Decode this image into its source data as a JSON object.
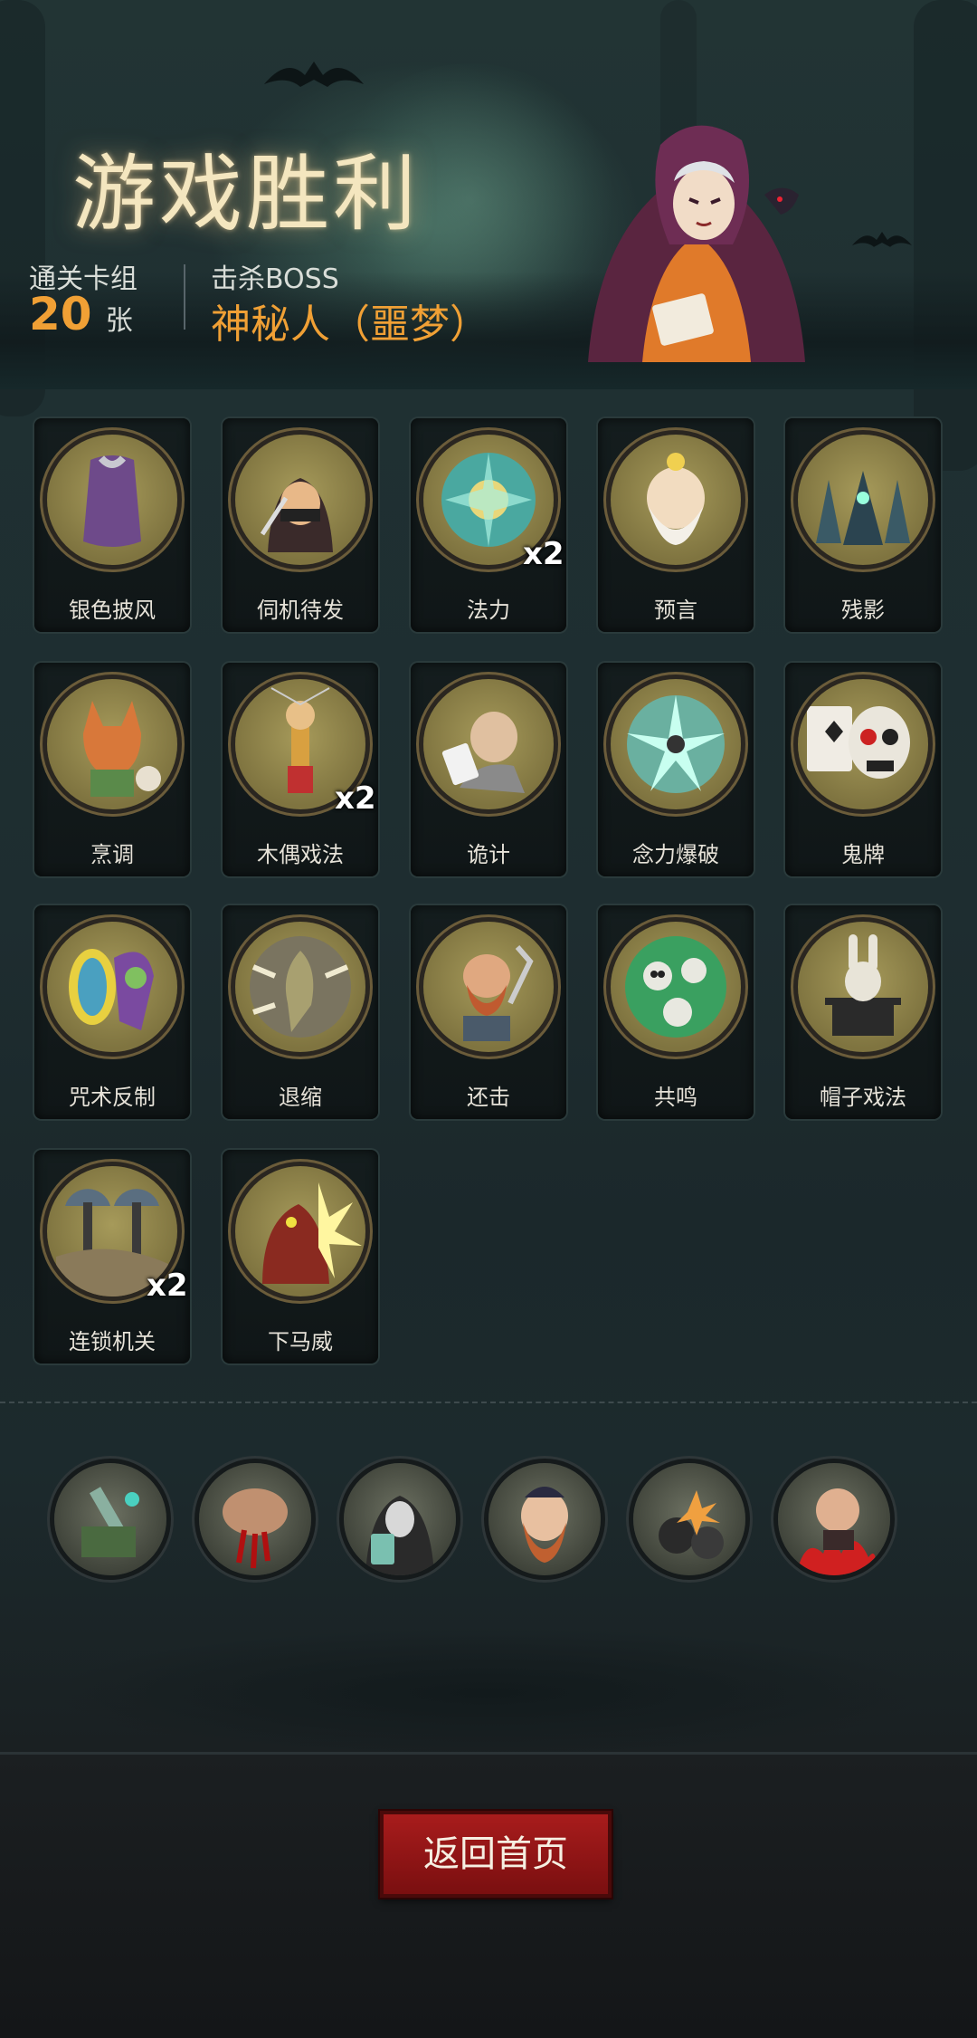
{
  "result": {
    "title": "游戏胜利",
    "deck_label": "通关卡组",
    "deck_count": "20",
    "deck_unit": "张",
    "boss_label": "击杀BOSS",
    "boss_name": "神秘人（噩梦）"
  },
  "cards": [
    {
      "name": "银色披风",
      "mult": "",
      "art": "cloak-icon"
    },
    {
      "name": "伺机待发",
      "mult": "",
      "art": "masked-thief-icon"
    },
    {
      "name": "法力",
      "mult": "x2",
      "art": "mana-burst-icon"
    },
    {
      "name": "预言",
      "mult": "",
      "art": "old-seer-icon"
    },
    {
      "name": "残影",
      "mult": "",
      "art": "shadow-clones-icon"
    },
    {
      "name": "烹调",
      "mult": "",
      "art": "fox-chef-icon"
    },
    {
      "name": "木偶戏法",
      "mult": "x2",
      "art": "puppet-icon"
    },
    {
      "name": "诡计",
      "mult": "",
      "art": "card-sharp-icon"
    },
    {
      "name": "念力爆破",
      "mult": "",
      "art": "psychic-blast-icon"
    },
    {
      "name": "鬼牌",
      "mult": "",
      "art": "skull-joker-icon"
    },
    {
      "name": "咒术反制",
      "mult": "",
      "art": "spell-mirror-icon"
    },
    {
      "name": "退缩",
      "mult": "",
      "art": "retreat-icon"
    },
    {
      "name": "还击",
      "mult": "",
      "art": "dwarf-warrior-icon"
    },
    {
      "name": "共鸣",
      "mult": "",
      "art": "green-skulls-icon"
    },
    {
      "name": "帽子戏法",
      "mult": "",
      "art": "hat-rabbit-icon"
    },
    {
      "name": "连锁机关",
      "mult": "x2",
      "art": "blade-trap-icon"
    },
    {
      "name": "下马威",
      "mult": "",
      "art": "red-brute-icon"
    }
  ],
  "relics": [
    {
      "art": "dagger-relic-icon"
    },
    {
      "art": "bleeding-fist-relic-icon"
    },
    {
      "art": "hooded-card-relic-icon"
    },
    {
      "art": "bearded-pirate-relic-icon"
    },
    {
      "art": "bomb-relic-icon"
    },
    {
      "art": "fire-goblin-relic-icon"
    }
  ],
  "footer": {
    "back_label": "返回首页"
  },
  "colors": {
    "accent": "#f0a035",
    "button": "#a81c1c",
    "card_disc": "#a69a5a"
  }
}
